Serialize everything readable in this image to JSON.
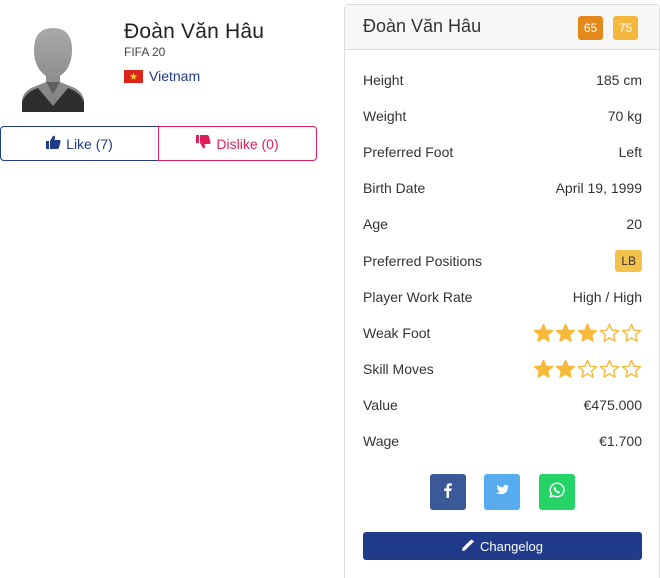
{
  "player": {
    "name": "Đoàn Văn Hâu",
    "game": "FIFA 20",
    "nation": "Vietnam"
  },
  "votes": {
    "like_label": "Like (7)",
    "dislike_label": "Dislike (0)"
  },
  "panel": {
    "title": "Đoàn Văn Hâu",
    "overall": "65",
    "potential": "75",
    "overall_color": "#e3891c",
    "potential_color": "#f3b73b"
  },
  "info": {
    "height": {
      "label": "Height",
      "value": "185 cm"
    },
    "weight": {
      "label": "Weight",
      "value": "70 kg"
    },
    "foot": {
      "label": "Preferred Foot",
      "value": "Left"
    },
    "birth": {
      "label": "Birth Date",
      "value": "April 19, 1999"
    },
    "age": {
      "label": "Age",
      "value": "20"
    },
    "positions": {
      "label": "Preferred Positions",
      "value": "LB"
    },
    "workrate": {
      "label": "Player Work Rate",
      "value": "High / High"
    },
    "weakfoot": {
      "label": "Weak Foot",
      "stars": 3,
      "max": 5
    },
    "skillmoves": {
      "label": "Skill Moves",
      "stars": 2,
      "max": 5
    },
    "value": {
      "label": "Value",
      "value": "€475.000"
    },
    "wage": {
      "label": "Wage",
      "value": "€1.700"
    }
  },
  "share": {
    "icons": [
      "facebook-icon",
      "twitter-icon",
      "whatsapp-icon"
    ]
  },
  "changelog_label": "Changelog",
  "colors": {
    "brand_blue": "#1f3b8a",
    "dislike_red": "#e01e5a",
    "star_gold": "#f6b93b"
  }
}
